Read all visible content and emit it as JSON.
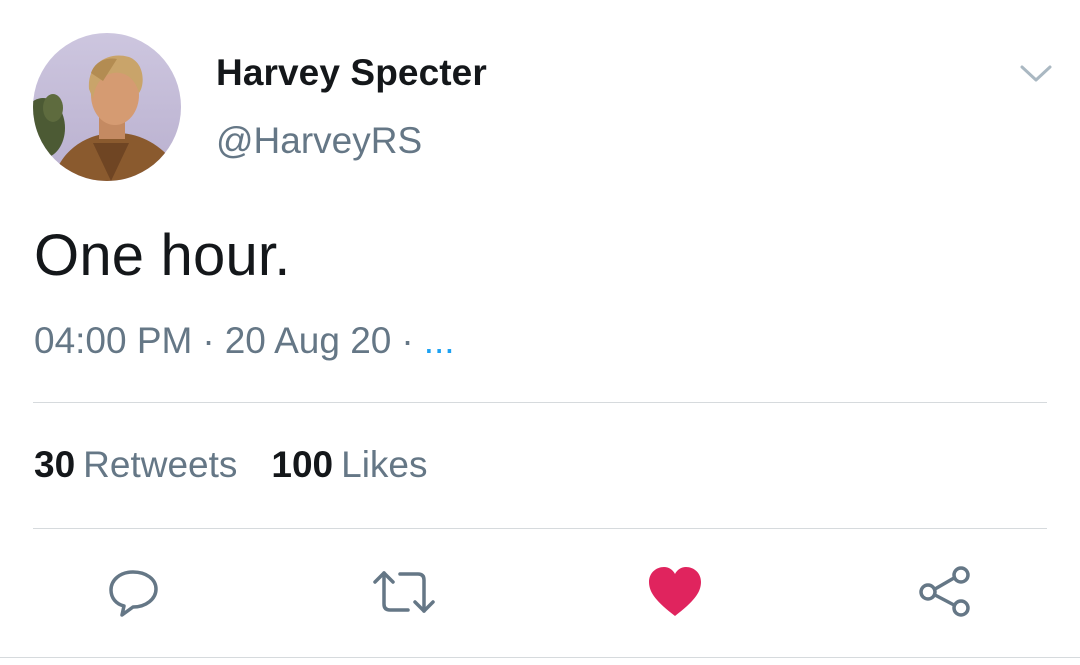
{
  "user": {
    "name": "Harvey Specter",
    "handle": "@HarveyRS"
  },
  "tweet": {
    "text": "One hour.",
    "time": "04:00 PM",
    "date": "20 Aug 20",
    "separator": "·",
    "more": "..."
  },
  "stats": {
    "retweets_count": "30",
    "retweets_label": "Retweets",
    "likes_count": "100",
    "likes_label": "Likes"
  },
  "actions": {
    "reply_icon": "comment-bubble-icon",
    "retweet_icon": "retweet-arrows-icon",
    "like_icon": "heart-filled-icon",
    "share_icon": "share-nodes-icon"
  },
  "colors": {
    "text_primary": "#14171a",
    "text_secondary": "#657786",
    "link_blue": "#1da1f2",
    "like_red": "#e0245e",
    "icon_gray": "#657786",
    "divider": "#d6dadd"
  }
}
